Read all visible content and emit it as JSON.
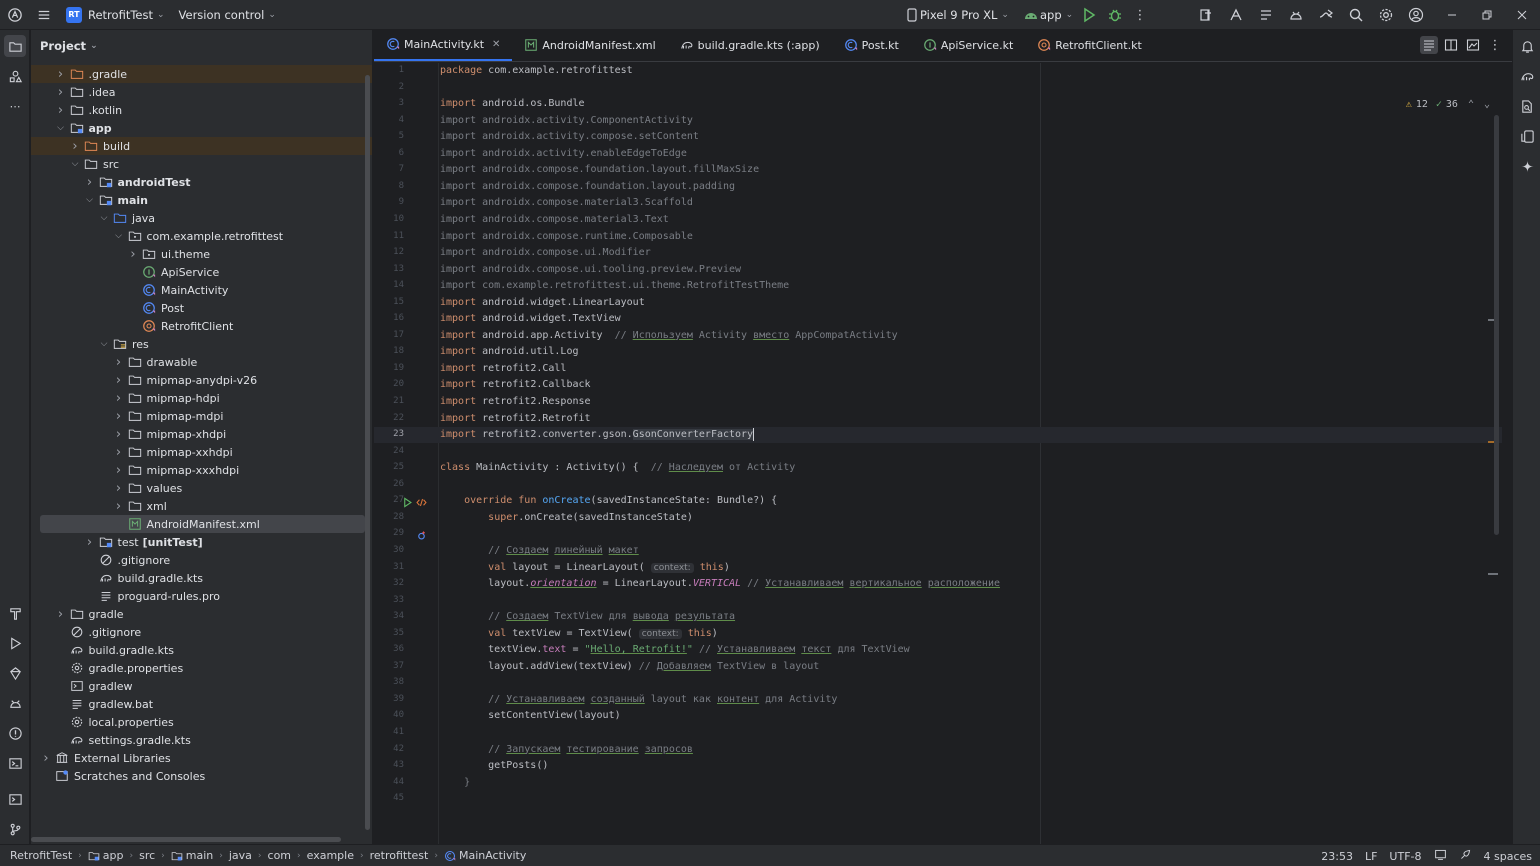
{
  "titlebar": {
    "project_badge": "RT",
    "project_name": "RetrofitTest",
    "vcs_label": "Version control",
    "device": "Pixel 9 Pro XL",
    "run_config": "app"
  },
  "project_panel": {
    "title": "Project",
    "tree": [
      {
        "label": ".gradle",
        "depth": 1,
        "arrow": "right",
        "icon": "folder-excluded",
        "excluded": true
      },
      {
        "label": ".idea",
        "depth": 1,
        "arrow": "right",
        "icon": "folder"
      },
      {
        "label": ".kotlin",
        "depth": 1,
        "arrow": "right",
        "icon": "folder"
      },
      {
        "label": "app",
        "depth": 1,
        "arrow": "down",
        "icon": "folder-module",
        "bold": true
      },
      {
        "label": "build",
        "depth": 2,
        "arrow": "right",
        "icon": "folder-excluded",
        "excluded": true
      },
      {
        "label": "src",
        "depth": 2,
        "arrow": "down",
        "icon": "folder"
      },
      {
        "label": "androidTest",
        "depth": 3,
        "arrow": "right",
        "icon": "folder-module",
        "bold": true
      },
      {
        "label": "main",
        "depth": 3,
        "arrow": "down",
        "icon": "folder-module",
        "bold": true
      },
      {
        "label": "java",
        "depth": 4,
        "arrow": "down",
        "icon": "folder-source"
      },
      {
        "label": "com.example.retrofittest",
        "depth": 5,
        "arrow": "down",
        "icon": "package"
      },
      {
        "label": "ui.theme",
        "depth": 6,
        "arrow": "right",
        "icon": "package"
      },
      {
        "label": "ApiService",
        "depth": 6,
        "arrow": "",
        "icon": "kotlin-interface"
      },
      {
        "label": "MainActivity",
        "depth": 6,
        "arrow": "",
        "icon": "kotlin-class"
      },
      {
        "label": "Post",
        "depth": 6,
        "arrow": "",
        "icon": "kotlin-class"
      },
      {
        "label": "RetrofitClient",
        "depth": 6,
        "arrow": "",
        "icon": "kotlin-object"
      },
      {
        "label": "res",
        "depth": 4,
        "arrow": "down",
        "icon": "folder-res"
      },
      {
        "label": "drawable",
        "depth": 5,
        "arrow": "right",
        "icon": "folder"
      },
      {
        "label": "mipmap-anydpi-v26",
        "depth": 5,
        "arrow": "right",
        "icon": "folder"
      },
      {
        "label": "mipmap-hdpi",
        "depth": 5,
        "arrow": "right",
        "icon": "folder"
      },
      {
        "label": "mipmap-mdpi",
        "depth": 5,
        "arrow": "right",
        "icon": "folder"
      },
      {
        "label": "mipmap-xhdpi",
        "depth": 5,
        "arrow": "right",
        "icon": "folder"
      },
      {
        "label": "mipmap-xxhdpi",
        "depth": 5,
        "arrow": "right",
        "icon": "folder"
      },
      {
        "label": "mipmap-xxxhdpi",
        "depth": 5,
        "arrow": "right",
        "icon": "folder"
      },
      {
        "label": "values",
        "depth": 5,
        "arrow": "right",
        "icon": "folder"
      },
      {
        "label": "xml",
        "depth": 5,
        "arrow": "right",
        "icon": "folder"
      },
      {
        "label": "AndroidManifest.xml",
        "depth": 5,
        "arrow": "",
        "icon": "manifest",
        "selected": true
      },
      {
        "label": "test",
        "suffix": "[unitTest]",
        "depth": 3,
        "arrow": "right",
        "icon": "folder-module"
      },
      {
        "label": ".gitignore",
        "depth": 3,
        "arrow": "",
        "icon": "ignore"
      },
      {
        "label": "build.gradle.kts",
        "depth": 3,
        "arrow": "",
        "icon": "gradle"
      },
      {
        "label": "proguard-rules.pro",
        "depth": 3,
        "arrow": "",
        "icon": "text"
      },
      {
        "label": "gradle",
        "depth": 1,
        "arrow": "right",
        "icon": "folder"
      },
      {
        "label": ".gitignore",
        "depth": 1,
        "arrow": "",
        "icon": "ignore"
      },
      {
        "label": "build.gradle.kts",
        "depth": 1,
        "arrow": "",
        "icon": "gradle"
      },
      {
        "label": "gradle.properties",
        "depth": 1,
        "arrow": "",
        "icon": "settings"
      },
      {
        "label": "gradlew",
        "depth": 1,
        "arrow": "",
        "icon": "terminal"
      },
      {
        "label": "gradlew.bat",
        "depth": 1,
        "arrow": "",
        "icon": "text"
      },
      {
        "label": "local.properties",
        "depth": 1,
        "arrow": "",
        "icon": "settings"
      },
      {
        "label": "settings.gradle.kts",
        "depth": 1,
        "arrow": "",
        "icon": "gradle"
      },
      {
        "label": "External Libraries",
        "depth": 0,
        "arrow": "right",
        "icon": "library"
      },
      {
        "label": "Scratches and Consoles",
        "depth": 0,
        "arrow": "",
        "icon": "scratches"
      }
    ]
  },
  "tabs": [
    {
      "label": "MainActivity.kt",
      "icon": "kotlin-class",
      "active": true,
      "closable": true
    },
    {
      "label": "AndroidManifest.xml",
      "icon": "manifest"
    },
    {
      "label": "build.gradle.kts (:app)",
      "icon": "gradle"
    },
    {
      "label": "Post.kt",
      "icon": "kotlin-class"
    },
    {
      "label": "ApiService.kt",
      "icon": "kotlin-interface"
    },
    {
      "label": "RetrofitClient.kt",
      "icon": "kotlin-object"
    }
  ],
  "inspections": {
    "warnings": "12",
    "checks": "36"
  },
  "code": {
    "current_line": 23,
    "lines": [
      [
        [
          "kw",
          "package "
        ],
        [
          "",
          "com.example.retrofittest"
        ]
      ],
      [],
      [
        [
          "kw",
          "import "
        ],
        [
          "",
          "android.os.Bundle"
        ]
      ],
      [
        [
          "dim",
          "import androidx.activity.ComponentActivity"
        ]
      ],
      [
        [
          "dim",
          "import androidx.activity.compose.setContent"
        ]
      ],
      [
        [
          "dim",
          "import androidx.activity.enableEdgeToEdge"
        ]
      ],
      [
        [
          "dim",
          "import androidx.compose.foundation.layout.fillMaxSize"
        ]
      ],
      [
        [
          "dim",
          "import androidx.compose.foundation.layout.padding"
        ]
      ],
      [
        [
          "dim",
          "import androidx.compose.material3.Scaffold"
        ]
      ],
      [
        [
          "dim",
          "import androidx.compose.material3.Text"
        ]
      ],
      [
        [
          "dim",
          "import androidx.compose.runtime.Composable"
        ]
      ],
      [
        [
          "dim",
          "import androidx.compose.ui.Modifier"
        ]
      ],
      [
        [
          "dim",
          "import androidx.compose.ui.tooling.preview.Preview"
        ]
      ],
      [
        [
          "dim",
          "import com.example.retrofittest.ui.theme.RetrofitTestTheme"
        ]
      ],
      [
        [
          "kw",
          "import "
        ],
        [
          "",
          "android.widget.LinearLayout"
        ]
      ],
      [
        [
          "kw",
          "import "
        ],
        [
          "",
          "android.widget.TextView"
        ]
      ],
      [
        [
          "kw",
          "import "
        ],
        [
          "",
          "android.app.Activity  "
        ],
        [
          "cm",
          "// "
        ],
        [
          "cm ul",
          "Используем"
        ],
        [
          "cm",
          " Activity "
        ],
        [
          "cm ul",
          "вместо"
        ],
        [
          "cm",
          " AppCompatActivity"
        ]
      ],
      [
        [
          "kw",
          "import "
        ],
        [
          "",
          "android.util.Log"
        ]
      ],
      [
        [
          "kw",
          "import "
        ],
        [
          "",
          "retrofit2.Call"
        ]
      ],
      [
        [
          "kw",
          "import "
        ],
        [
          "",
          "retrofit2.Callback"
        ]
      ],
      [
        [
          "kw",
          "import "
        ],
        [
          "",
          "retrofit2.Response"
        ]
      ],
      [
        [
          "kw",
          "import "
        ],
        [
          "",
          "retrofit2.Retrofit"
        ]
      ],
      [
        [
          "kw",
          "import "
        ],
        [
          "",
          "retrofit2.converter.gson."
        ],
        [
          "hl",
          "GsonConverterFactory"
        ],
        [
          "caret",
          ""
        ]
      ],
      [],
      [
        [
          "kw",
          "class "
        ],
        [
          "",
          "MainActivity : Activity() {  "
        ],
        [
          "cm",
          "// "
        ],
        [
          "cm ul",
          "Наследуем"
        ],
        [
          "cm",
          " от Activity"
        ]
      ],
      [],
      [
        [
          "",
          "    "
        ],
        [
          "kw",
          "override fun "
        ],
        [
          "fn",
          "onCreate"
        ],
        [
          "",
          "(savedInstanceState: Bundle?) {"
        ]
      ],
      [
        [
          "",
          "        "
        ],
        [
          "kw",
          "super"
        ],
        [
          "",
          ".onCreate(savedInstanceState)"
        ]
      ],
      [],
      [
        [
          "",
          "        "
        ],
        [
          "cm",
          "// "
        ],
        [
          "cm ul",
          "Создаем"
        ],
        [
          "cm",
          " "
        ],
        [
          "cm ul",
          "линейный"
        ],
        [
          "cm",
          " "
        ],
        [
          "cm ul",
          "макет"
        ]
      ],
      [
        [
          "",
          "        "
        ],
        [
          "kw",
          "val "
        ],
        [
          "",
          "layout = LinearLayout( "
        ],
        [
          "hint",
          "context:"
        ],
        [
          "kw",
          " this"
        ],
        [
          "",
          ")"
        ]
      ],
      [
        [
          "",
          "        layout."
        ],
        [
          "prop ital ul",
          "orientation"
        ],
        [
          "",
          " = LinearLayout."
        ],
        [
          "prop ital",
          "VERTICAL"
        ],
        [
          "",
          " "
        ],
        [
          "cm",
          "// "
        ],
        [
          "cm ul",
          "Устанавливаем"
        ],
        [
          "cm",
          " "
        ],
        [
          "cm ul",
          "вертикальное"
        ],
        [
          "cm",
          " "
        ],
        [
          "cm ul",
          "расположение"
        ]
      ],
      [],
      [
        [
          "",
          "        "
        ],
        [
          "cm",
          "// "
        ],
        [
          "cm ul",
          "Создаем"
        ],
        [
          "cm",
          " TextView для "
        ],
        [
          "cm ul",
          "вывода"
        ],
        [
          "cm",
          " "
        ],
        [
          "cm ul",
          "результата"
        ]
      ],
      [
        [
          "",
          "        "
        ],
        [
          "kw",
          "val "
        ],
        [
          "",
          "textView = TextView( "
        ],
        [
          "hint",
          "context:"
        ],
        [
          "kw",
          " this"
        ],
        [
          "",
          ")"
        ]
      ],
      [
        [
          "",
          "        textView."
        ],
        [
          "prop",
          "text"
        ],
        [
          "",
          " = "
        ],
        [
          "str",
          "\""
        ],
        [
          "str ul",
          "Hello, Retrofit!"
        ],
        [
          "str",
          "\""
        ],
        [
          "",
          " "
        ],
        [
          "cm",
          "// "
        ],
        [
          "cm ul",
          "Устанавливаем"
        ],
        [
          "cm",
          " "
        ],
        [
          "cm ul",
          "текст"
        ],
        [
          "cm",
          " для TextView"
        ]
      ],
      [
        [
          "",
          "        layout.addView(textView) "
        ],
        [
          "cm",
          "// "
        ],
        [
          "cm ul",
          "Добавляем"
        ],
        [
          "cm",
          " TextView в layout"
        ]
      ],
      [],
      [
        [
          "",
          "        "
        ],
        [
          "cm",
          "// "
        ],
        [
          "cm ul",
          "Устанавливаем"
        ],
        [
          "cm",
          " "
        ],
        [
          "cm ul",
          "созданный"
        ],
        [
          "cm",
          " layout как "
        ],
        [
          "cm ul",
          "контент"
        ],
        [
          "cm",
          " для Activity"
        ]
      ],
      [
        [
          "",
          "        setContentView(layout)"
        ]
      ],
      [],
      [
        [
          "",
          "        "
        ],
        [
          "cm",
          "// "
        ],
        [
          "cm ul",
          "Запускаем"
        ],
        [
          "cm",
          " "
        ],
        [
          "cm ul",
          "тестирование"
        ],
        [
          "cm",
          " "
        ],
        [
          "cm ul",
          "запросов"
        ]
      ],
      [
        [
          "",
          "        getPosts()"
        ]
      ],
      [
        [
          "",
          "    "
        ],
        [
          "dim",
          "}"
        ]
      ],
      []
    ]
  },
  "breadcrumbs": [
    "RetrofitTest",
    "app",
    "src",
    "main",
    "java",
    "com",
    "example",
    "retrofittest",
    "MainActivity"
  ],
  "status": {
    "position": "23:53",
    "line_sep": "LF",
    "encoding": "UTF-8",
    "indent": "4 spaces"
  }
}
